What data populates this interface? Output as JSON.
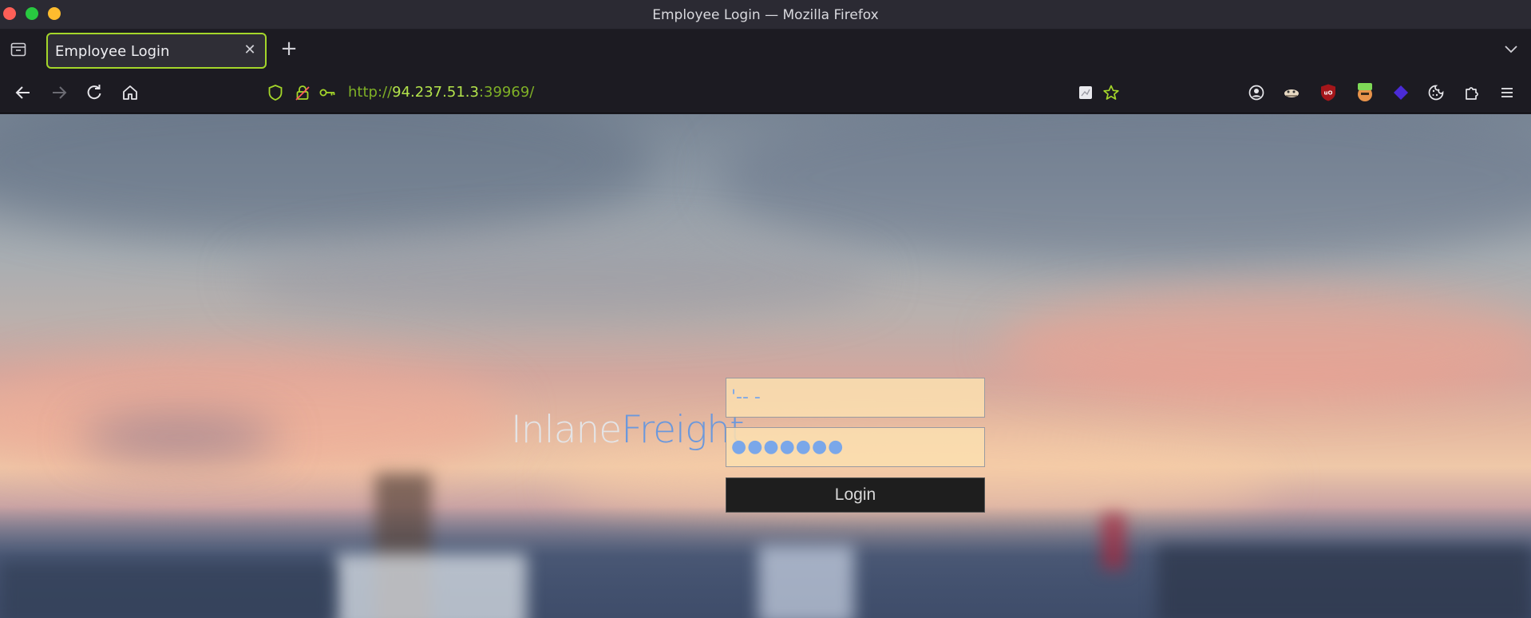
{
  "window": {
    "title": "Employee Login — Mozilla Firefox"
  },
  "tabs": [
    {
      "title": "Employee Login",
      "active": true
    }
  ],
  "nav": {
    "url": {
      "scheme": "http://",
      "host": "94.237.51.3",
      "port": ":39969/"
    }
  },
  "page": {
    "brand_part1": "Inlane",
    "brand_part2": "Freight",
    "username_value": "'-- -",
    "password_value": "●●●●●●●",
    "login_label": "Login"
  },
  "colors": {
    "tab_accent": "#a4d62a",
    "url_host": "#b3e34b",
    "brand_accent": "#6b98dc",
    "input_fill": "#fadeaf"
  }
}
